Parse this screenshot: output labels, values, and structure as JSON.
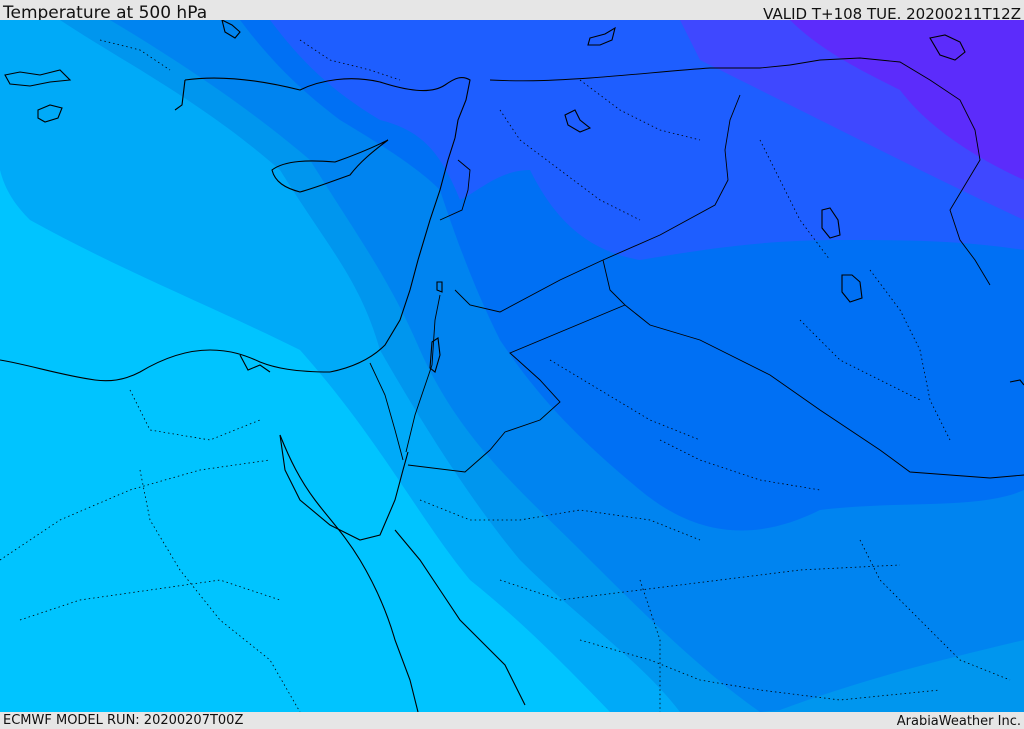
{
  "header": {
    "title": "Temperature at 500 hPa",
    "valid": "VALID T+108 TUE. 20200211T12Z"
  },
  "footer": {
    "model_run": "ECMWF MODEL RUN: 20200207T00Z",
    "credit": "ArabiaWeather Inc."
  },
  "colors": {
    "band_1": "#00c4ff",
    "band_2": "#00aaf8",
    "band_3": "#0096ee",
    "band_4": "#0084f0",
    "band_5": "#0070f4",
    "band_6": "#1e5eff",
    "band_7": "#3f48ff",
    "band_8": "#5c2cfb",
    "border": "#000000"
  }
}
